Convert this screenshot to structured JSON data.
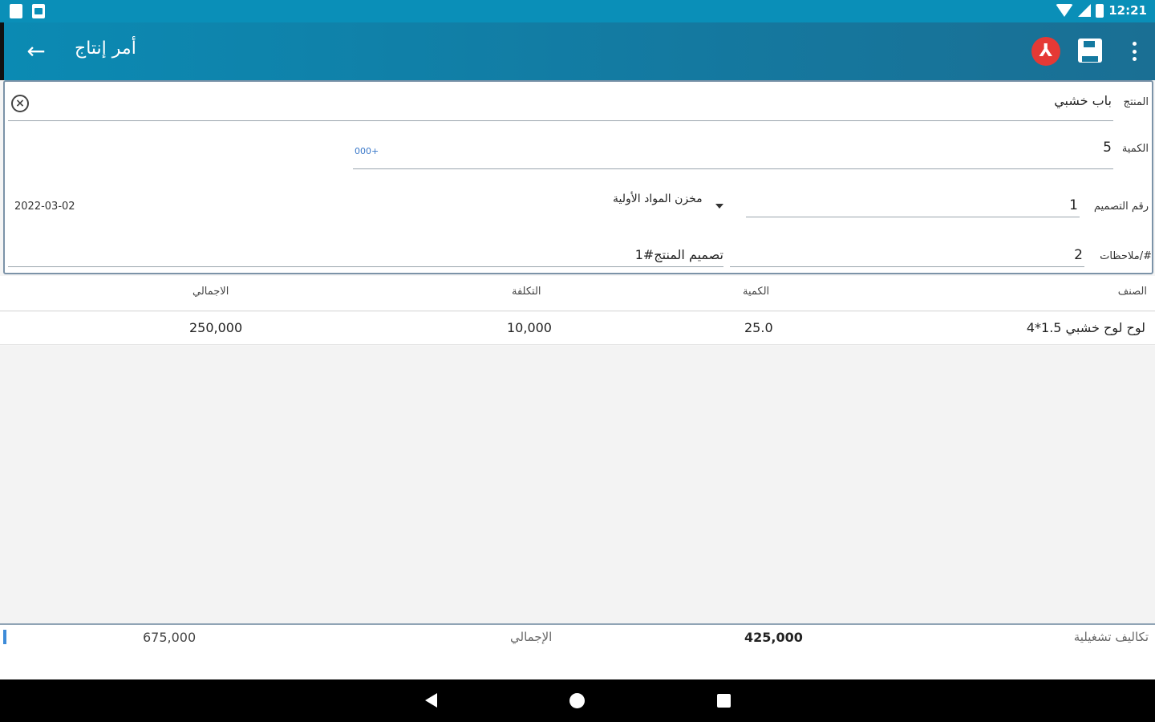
{
  "status_bar": {
    "time": "12:21"
  },
  "app_bar": {
    "title": "أمر إنتاج",
    "back_icon": "arrow-back-icon",
    "pdf_icon": "pdf-icon",
    "save_icon": "save-icon",
    "menu_icon": "more-vert-icon"
  },
  "form": {
    "product_label": "المنتج",
    "product_value": "باب خشبي",
    "quantity_label": "الكمية",
    "quantity_value": "5",
    "quantity_hint": "000+",
    "design_no_label": "رقم التصميم",
    "design_no_value": "1",
    "warehouse_value": "مخزن المواد الأولية",
    "date_value": "2022-03-02",
    "notes_label": "#/ملاحظات",
    "notes_value": "2",
    "design_name_value": "تصميم المنتج#1"
  },
  "table": {
    "headers": {
      "item": "الصنف",
      "quantity": "الكمية",
      "cost": "التكلفة",
      "total": "الاجمالي"
    },
    "rows": [
      {
        "item": "لوح لوح خشبي 1.5*4",
        "quantity": "25.0",
        "cost": "10,000",
        "total": "250,000"
      }
    ]
  },
  "footer": {
    "operating_costs_label": "تكاليف تشغيلية",
    "operating_costs_value": "425,000",
    "total_label": "الإجمالي",
    "total_value": "675,000"
  },
  "colors": {
    "app_bar": "#0b8ab3",
    "status_bar": "#0a8fb8",
    "pdf": "#e53935",
    "accent_hint": "#3a78c9"
  }
}
